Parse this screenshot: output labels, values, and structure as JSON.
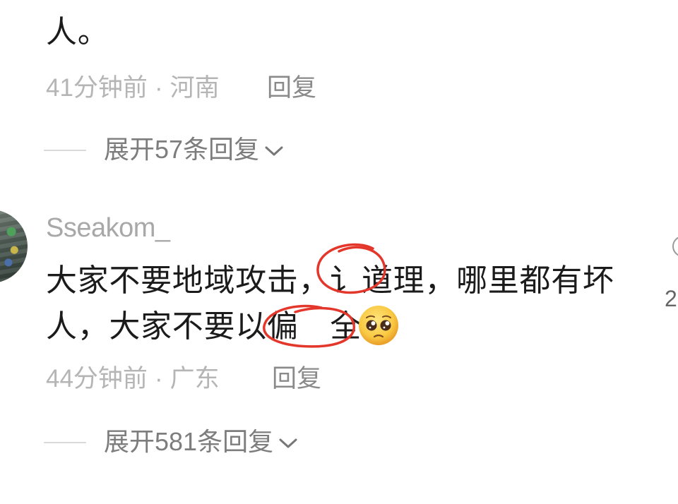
{
  "comments": [
    {
      "text_line_1": "人。",
      "time": "41分钟前",
      "separator": "·",
      "location": "河南",
      "reply_label": "回复",
      "expand_label": "展开57条回复",
      "expand_icon": "chevron-down-icon"
    },
    {
      "avatar": "user-avatar",
      "username": "Sseakom_",
      "text_line_1": "大家不要地域攻击，讠道理，哪里都有坏",
      "text_line_2": "人，大家不要以偏　全",
      "emoji_icon": "pleading-face-emoji",
      "time": "44分钟前",
      "separator": "·",
      "location": "广东",
      "reply_label": "回复",
      "expand_label": "展开581条回复",
      "expand_icon": "chevron-down-icon"
    }
  ],
  "like": {
    "icon": "like-icon",
    "count_partial": "2"
  },
  "colors": {
    "text": "#1b1b1b",
    "meta": "#b5b5b5",
    "reply": "#8a8a8a",
    "expand": "#7d7d7d",
    "username": "#a8a8a8",
    "annotation": "#e4372c"
  }
}
